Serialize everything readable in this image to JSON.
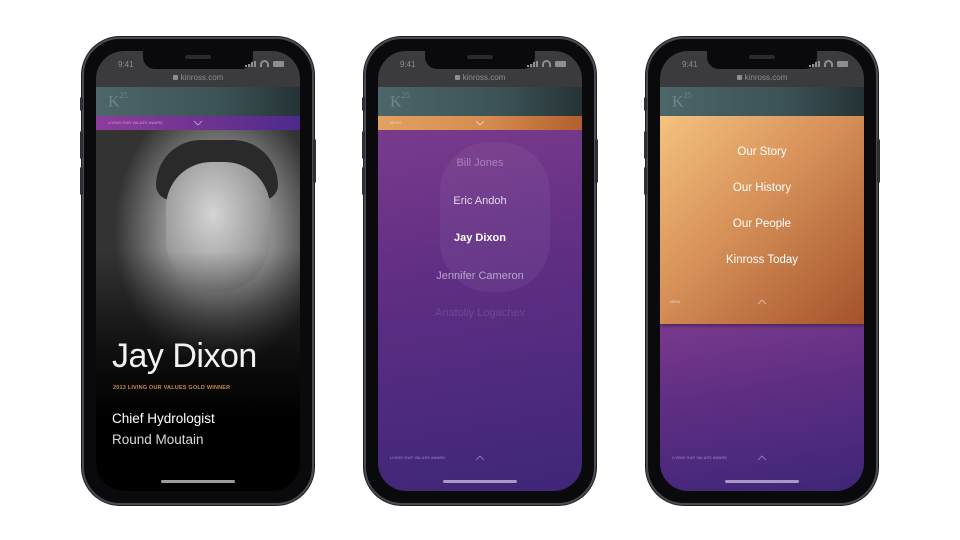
{
  "status": {
    "time": "9:41",
    "url": "kinross.com"
  },
  "brand": {
    "logo_letter": "K",
    "logo_super": "25"
  },
  "screens": [
    {
      "ribbon_label": "Living our values award",
      "profile": {
        "name": "Jay Dixon",
        "award": "2013 LIVING OUR VALUES GOLD WINNER",
        "role": "Chief Hydrologist",
        "location": "Round Moutain"
      }
    },
    {
      "ribbon_label": "Menu",
      "people": [
        "Bill Jones",
        "Eric Andoh",
        "Jay Dixon",
        "Jennifer Cameron",
        "Anatoliy Logachev"
      ],
      "selected_person": "Jay Dixon",
      "footer_label": "Living our values award"
    },
    {
      "menu_items": [
        "Our Story",
        "Our History",
        "Our People",
        "Kinross Today"
      ],
      "menu_label": "Menu",
      "footer_label": "Living our values award"
    }
  ],
  "colors": {
    "accent_purple": "#6a3290",
    "accent_copper": "#d58b4f",
    "brand_teal": "#4d666a",
    "award_gold": "#c98a4a"
  }
}
